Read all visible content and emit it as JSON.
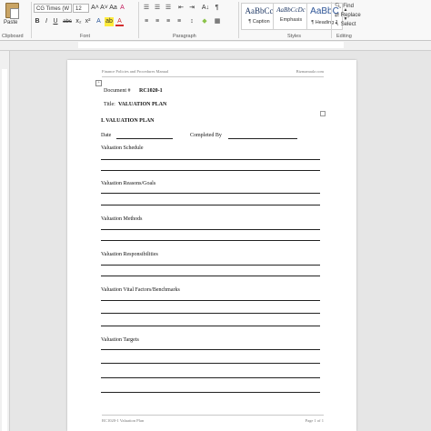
{
  "ribbon": {
    "paste_label": "Paste",
    "font_name": "CG Times (W",
    "font_size": "12",
    "font_grow": "A˄",
    "font_shrink": "A˅",
    "change_case": "Aa",
    "clear_format": "A",
    "bold": "B",
    "italic": "I",
    "underline": "U",
    "strikethrough": "abc",
    "subscript": "x₂",
    "superscript": "x²",
    "text_effects": "A",
    "highlight": "ab",
    "font_color": "A",
    "bullets": "☰",
    "numbering": "☰",
    "multilevel": "☰",
    "decrease_indent": "⇤",
    "increase_indent": "⇥",
    "sort": "A↓",
    "show_marks": "¶",
    "align_left": "≡",
    "align_center": "≡",
    "align_right": "≡",
    "justify": "≡",
    "line_spacing": "↕",
    "shading": "◆",
    "borders": "▦",
    "groups": {
      "clipboard": "Clipboard",
      "font": "Font",
      "paragraph": "Paragraph",
      "styles": "Styles",
      "editing": "Editing"
    },
    "styles": [
      {
        "sample": "AaBbCc",
        "name": "¶ Caption"
      },
      {
        "sample": "AaBbCcDc",
        "name": "Emphasis"
      },
      {
        "sample": "AaBbC",
        "name": "¶ Heading 1"
      }
    ],
    "editing": {
      "find": "Find",
      "replace": "Replace",
      "select": "Select"
    }
  },
  "document": {
    "header_left": "Finance Policies and Procedures Manual",
    "header_right": "Bizmanualz.com",
    "doc_number_label": "Document #",
    "doc_number": "RC1020-1",
    "title_label": "Title:",
    "title": "VALUATION PLAN",
    "heading": "I. VALUATION PLAN",
    "date_label": "Date",
    "completed_by_label": "Completed By",
    "sections": [
      "Valuation Schedule",
      "Valuation Reasons/Goals",
      "Valuation Methods",
      "Valuation Responsibilities",
      "Valuation Vital Factors/Benchmarks",
      "Valuation Targets"
    ],
    "footer_left": "RC1020-1 Valuation Plan",
    "footer_right": "Page 1 of 1"
  },
  "colors": {
    "accent": "#2b579a",
    "ribbon_bg": "#f8f8f8",
    "canvas": "#e6e6e6"
  }
}
